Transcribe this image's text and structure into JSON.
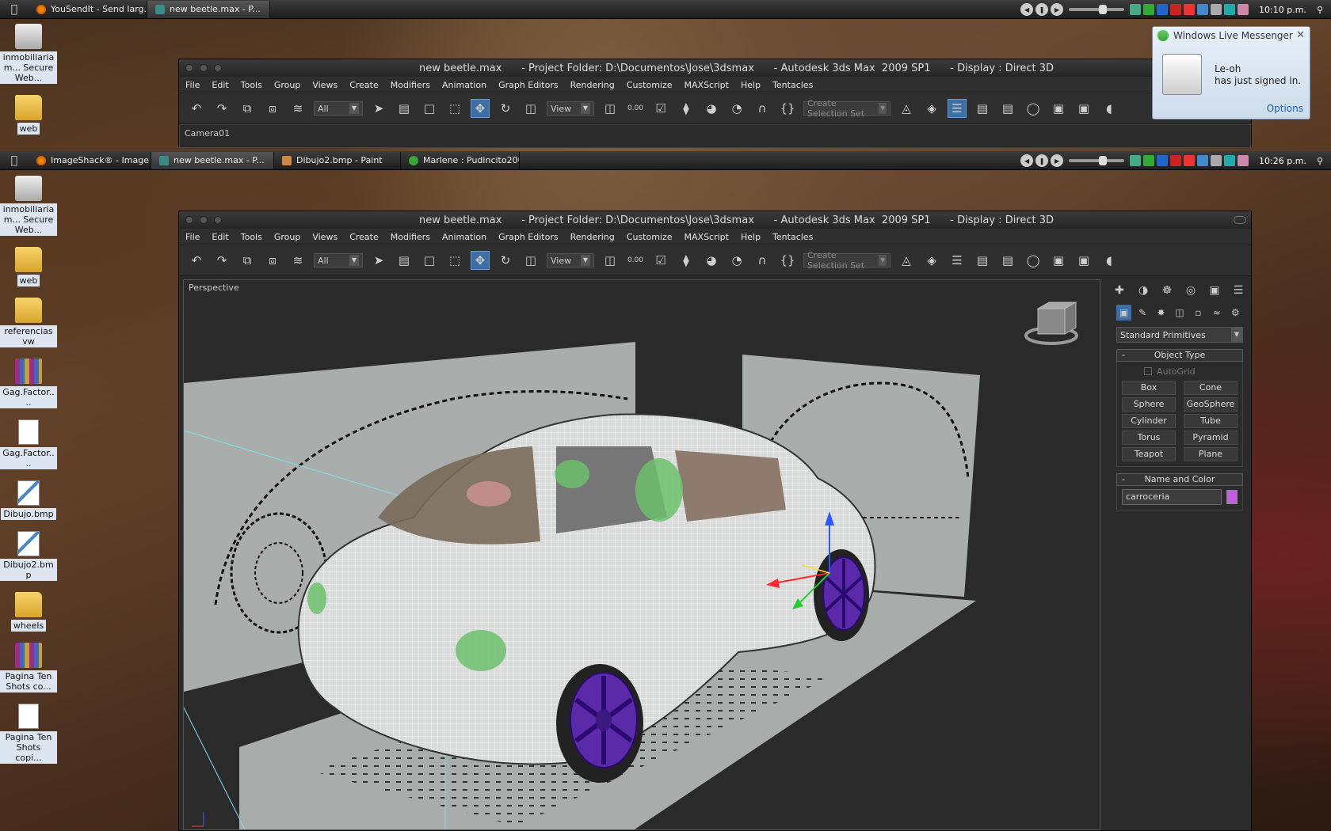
{
  "taskbar_top": {
    "tasks": [
      {
        "label": "YouSendIt - Send larg...",
        "active": false,
        "icon": "firefox-icon"
      },
      {
        "label": "new beetle.max      - P...",
        "active": true,
        "icon": "3dsmax-icon"
      }
    ],
    "clock": "10:10 p.m."
  },
  "taskbar_bottom": {
    "tasks": [
      {
        "label": "ImageShack® - Image ...",
        "active": false,
        "icon": "firefox-icon"
      },
      {
        "label": "new beetle.max      - P...",
        "active": true,
        "icon": "3dsmax-icon"
      },
      {
        "label": "Dibujo2.bmp - Paint",
        "active": false,
        "icon": "paint-icon"
      },
      {
        "label": "Marlene : Pudincito200...",
        "active": false,
        "icon": "messenger-icon"
      }
    ],
    "clock": "10:26 p.m."
  },
  "desktop_top": [
    {
      "label": "inmobiliariam... Secure Web...",
      "type": "drive"
    },
    {
      "label": "web",
      "type": "folder"
    }
  ],
  "desktop_bottom": [
    {
      "label": "inmobiliariam... Secure Web...",
      "type": "drive"
    },
    {
      "label": "web",
      "type": "folder"
    },
    {
      "label": "referencias vw",
      "type": "folder"
    },
    {
      "label": "Gag.Factor....",
      "type": "rar"
    },
    {
      "label": "Gag.Factor....",
      "type": "doc"
    },
    {
      "label": "Dibujo.bmp",
      "type": "paint"
    },
    {
      "label": "Dibujo2.bmp",
      "type": "paint"
    },
    {
      "label": "wheels",
      "type": "folder"
    },
    {
      "label": "Pagina Ten Shots co...",
      "type": "rar"
    },
    {
      "label": "Pagina Ten Shots copi...",
      "type": "doc"
    }
  ],
  "max_window": {
    "title": "new beetle.max      - Project Folder: D:\\Documentos\\Jose\\3dsmax      - Autodesk 3ds Max  2009 SP1      - Display : Direct 3D",
    "menu": [
      "File",
      "Edit",
      "Tools",
      "Group",
      "Views",
      "Create",
      "Modifiers",
      "Animation",
      "Graph Editors",
      "Rendering",
      "Customize",
      "MAXScript",
      "Help",
      "Tentacles"
    ],
    "selection_filter": "All",
    "reference_coord": "View",
    "selection_set_placeholder": "Create Selection Set",
    "spinner_snap": "0.00"
  },
  "top_viewport_label": "Camera01",
  "viewport_label": "Perspective",
  "command_panel": {
    "category": "Standard Primitives",
    "object_type_title": "Object Type",
    "autogrid_label": "AutoGrid",
    "buttons": [
      "Box",
      "Cone",
      "Sphere",
      "GeoSphere",
      "Cylinder",
      "Tube",
      "Torus",
      "Pyramid",
      "Teapot",
      "Plane"
    ],
    "name_color_title": "Name and Color",
    "object_name": "carroceria",
    "object_color": "#c060e0"
  },
  "messenger": {
    "title": "Windows Live Messenger",
    "contact": "Le-oh",
    "message": "has just signed in.",
    "options_label": "Options"
  },
  "colors": {
    "accent_blue": "#3d6ea6",
    "wire_white": "#ffffff",
    "wheel_purple": "#5a2aa8"
  }
}
